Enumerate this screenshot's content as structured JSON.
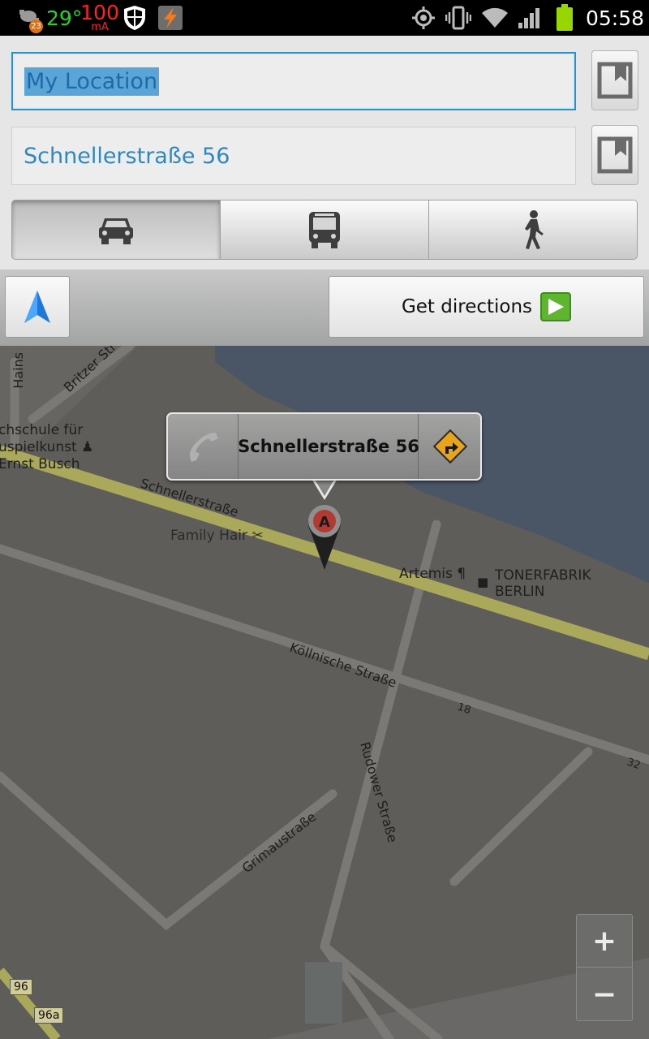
{
  "status_bar": {
    "notification_badge": "23",
    "temperature": "29°",
    "current_value": "100",
    "current_unit": "mA",
    "time": "05:58",
    "icons": [
      "notification-icon",
      "shield-icon",
      "flash-app-icon",
      "gps-icon",
      "vibrate-icon",
      "wifi-icon",
      "signal-icon",
      "battery-icon"
    ]
  },
  "route_form": {
    "from_value": "My Location",
    "to_value": "Schnellerstraße 56",
    "bookmark_icon": "bookmark-icon"
  },
  "transport_modes": {
    "selected": "car",
    "items": [
      {
        "id": "car",
        "icon": "car-icon"
      },
      {
        "id": "transit",
        "icon": "bus-icon"
      },
      {
        "id": "walk",
        "icon": "walking-icon"
      }
    ]
  },
  "actions": {
    "locate_icon": "location-arrow-icon",
    "get_directions_label": "Get directions",
    "go_icon": "green-arrow-icon"
  },
  "map": {
    "callout_title": "Schnellerstraße 56",
    "marker_letter": "A",
    "labels": {
      "hains": "Hains",
      "britzer": "Britzer Str",
      "school_1": "chschule für",
      "school_2": "uspielkunst",
      "school_3": "Ernst Busch",
      "schnellerstrasse": "Schnellerstraße",
      "family_hair": "Family Hair",
      "artemis": "Artemis",
      "tonerfabrik_1": "TONERFABRIK",
      "tonerfabrik_2": "BERLIN",
      "koellnische": "Köllnische Straße",
      "num_18": "18",
      "num_32": "32",
      "rudower": "Rudower Straße",
      "grimau": "Grimaustraße",
      "shield_96": "96",
      "shield_96a": "96a"
    },
    "colors": {
      "land": "#5f5d59",
      "water": "#4a5566",
      "main_road": "#aaa85a",
      "minor_road": "#7a7976"
    }
  },
  "zoom_controls": {
    "zoom_in": "+",
    "zoom_out": "−"
  }
}
